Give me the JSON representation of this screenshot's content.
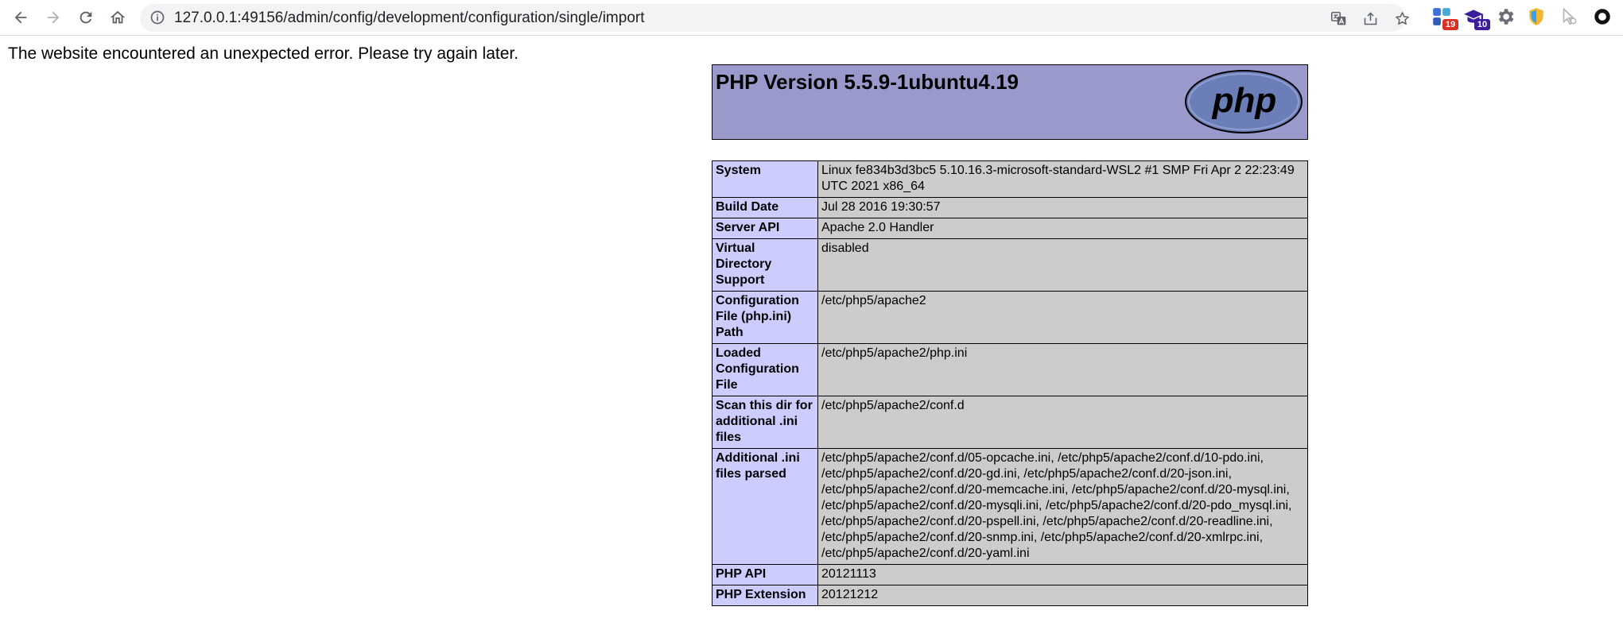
{
  "browser": {
    "url": "127.0.0.1:49156/admin/config/development/configuration/single/import",
    "extensions": [
      {
        "name": "puzzle-ext",
        "badge": "19",
        "badge_color": "#d93025"
      },
      {
        "name": "mortarboard-ext",
        "badge": "10",
        "badge_color": "#3c1d9c"
      },
      {
        "name": "gear-ext",
        "badge": ""
      },
      {
        "name": "shield-ext",
        "badge": ""
      },
      {
        "name": "cursor-ext",
        "badge": ""
      },
      {
        "name": "circle-ext",
        "badge": ""
      }
    ]
  },
  "page": {
    "error_message": "The website encountered an unexpected error. Please try again later."
  },
  "phpinfo": {
    "version_title": "PHP Version 5.5.9-1ubuntu4.19",
    "logo_text": "php",
    "header_color": "#9999cc",
    "key_color": "#ccccff",
    "value_color": "#cccccc",
    "rows": [
      {
        "key": "System",
        "value": "Linux fe834b3d3bc5 5.10.16.3-microsoft-standard-WSL2 #1 SMP Fri Apr 2 22:23:49 UTC 2021 x86_64"
      },
      {
        "key": "Build Date",
        "value": "Jul 28 2016 19:30:57"
      },
      {
        "key": "Server API",
        "value": "Apache 2.0 Handler"
      },
      {
        "key": "Virtual Directory Support",
        "value": "disabled"
      },
      {
        "key": "Configuration File (php.ini) Path",
        "value": "/etc/php5/apache2"
      },
      {
        "key": "Loaded Configuration File",
        "value": "/etc/php5/apache2/php.ini"
      },
      {
        "key": "Scan this dir for additional .ini files",
        "value": "/etc/php5/apache2/conf.d"
      },
      {
        "key": "Additional .ini files parsed",
        "value": "/etc/php5/apache2/conf.d/05-opcache.ini, /etc/php5/apache2/conf.d/10-pdo.ini, /etc/php5/apache2/conf.d/20-gd.ini, /etc/php5/apache2/conf.d/20-json.ini, /etc/php5/apache2/conf.d/20-memcache.ini, /etc/php5/apache2/conf.d/20-mysql.ini, /etc/php5/apache2/conf.d/20-mysqli.ini, /etc/php5/apache2/conf.d/20-pdo_mysql.ini, /etc/php5/apache2/conf.d/20-pspell.ini, /etc/php5/apache2/conf.d/20-readline.ini, /etc/php5/apache2/conf.d/20-snmp.ini, /etc/php5/apache2/conf.d/20-xmlrpc.ini, /etc/php5/apache2/conf.d/20-yaml.ini"
      },
      {
        "key": "PHP API",
        "value": "20121113"
      },
      {
        "key": "PHP Extension",
        "value": "20121212"
      }
    ]
  }
}
